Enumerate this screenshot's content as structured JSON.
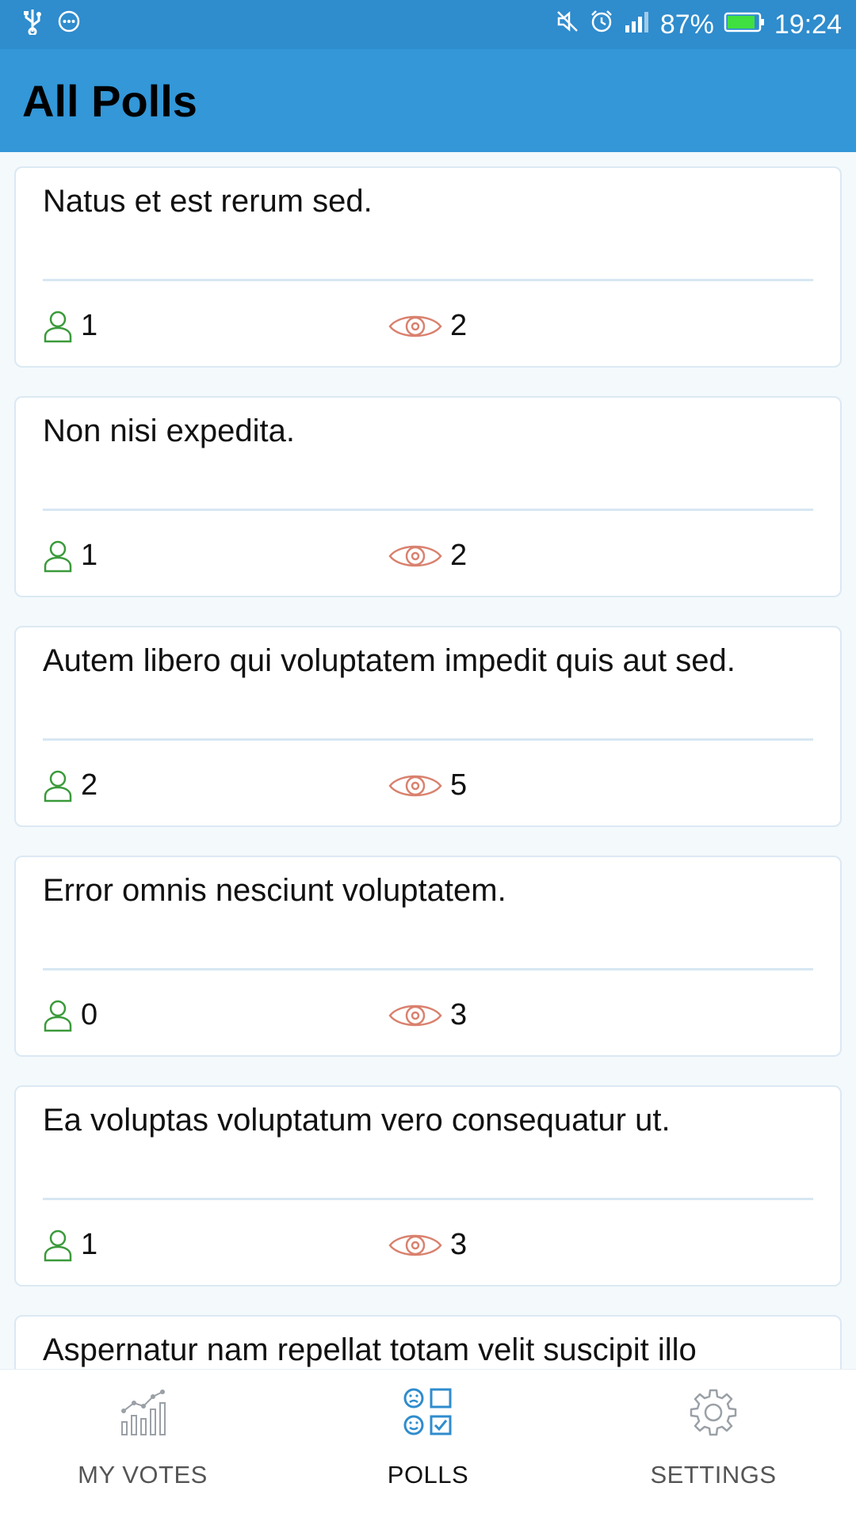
{
  "status_bar": {
    "battery": "87%",
    "time": "19:24"
  },
  "header": {
    "title": "All Polls"
  },
  "polls": [
    {
      "question": "Natus et est rerum sed.",
      "voters": "1",
      "views": "2"
    },
    {
      "question": "Non nisi expedita.",
      "voters": "1",
      "views": "2"
    },
    {
      "question": "Autem libero qui voluptatem impedit quis aut sed.",
      "voters": "2",
      "views": "5"
    },
    {
      "question": "Error omnis nesciunt voluptatem.",
      "voters": "0",
      "views": "3"
    },
    {
      "question": "Ea voluptas voluptatum vero consequatur ut.",
      "voters": "1",
      "views": "3"
    },
    {
      "question": "Aspernatur nam repellat totam velit suscipit illo"
    }
  ],
  "bottom_nav": {
    "items": [
      {
        "label": "MY VOTES",
        "icon": "chart-icon",
        "active": false
      },
      {
        "label": "POLLS",
        "icon": "polls-icon",
        "active": true
      },
      {
        "label": "SETTINGS",
        "icon": "gear-icon",
        "active": false
      }
    ]
  },
  "colors": {
    "status_bar": "#2f8ccd",
    "app_bar": "#3397d8",
    "voter_icon": "#3a9a3a",
    "view_icon": "#d9816e",
    "nav_active_icon": "#2f8ccd",
    "nav_inactive_icon": "#9aa0a6"
  }
}
